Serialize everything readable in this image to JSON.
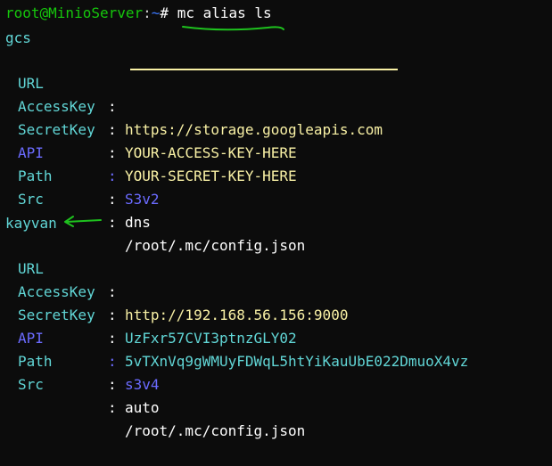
{
  "prompt": {
    "user": "root@MinioServer",
    "sep": ":",
    "path": "~",
    "symbol": "#",
    "command": "mc alias ls"
  },
  "aliases": [
    {
      "name": "gcs",
      "fields": [
        {
          "key": "URL",
          "value": "https://storage.googleapis.com"
        },
        {
          "key": "AccessKey",
          "value": "YOUR-ACCESS-KEY-HERE"
        },
        {
          "key": "SecretKey",
          "value": "YOUR-SECRET-KEY-HERE"
        },
        {
          "key": "API",
          "value": "S3v2"
        },
        {
          "key": "Path",
          "value": "dns"
        },
        {
          "key": "Src",
          "value": "/root/.mc/config.json"
        }
      ]
    },
    {
      "name": "kayvan",
      "fields": [
        {
          "key": "URL",
          "value": "http://192.168.56.156:9000"
        },
        {
          "key": "AccessKey",
          "value": "UzFxr57CVI3ptnzGLY02"
        },
        {
          "key": "SecretKey",
          "value": "5vTXnVq9gWMUyFDWqL5htYiKauUbE022DmuoX4vz"
        },
        {
          "key": "API",
          "value": "s3v4"
        },
        {
          "key": "Path",
          "value": "auto"
        },
        {
          "key": "Src",
          "value": "/root/.mc/config.json"
        }
      ]
    }
  ],
  "colors": {
    "background": "#0c0c0c",
    "prompt_user": "#16c60c",
    "prompt_path": "#3b78ff",
    "key": "#61d6d6",
    "url_value": "#f9f1a5",
    "api": "#6b6bff",
    "annotation": "#1ec21e"
  }
}
